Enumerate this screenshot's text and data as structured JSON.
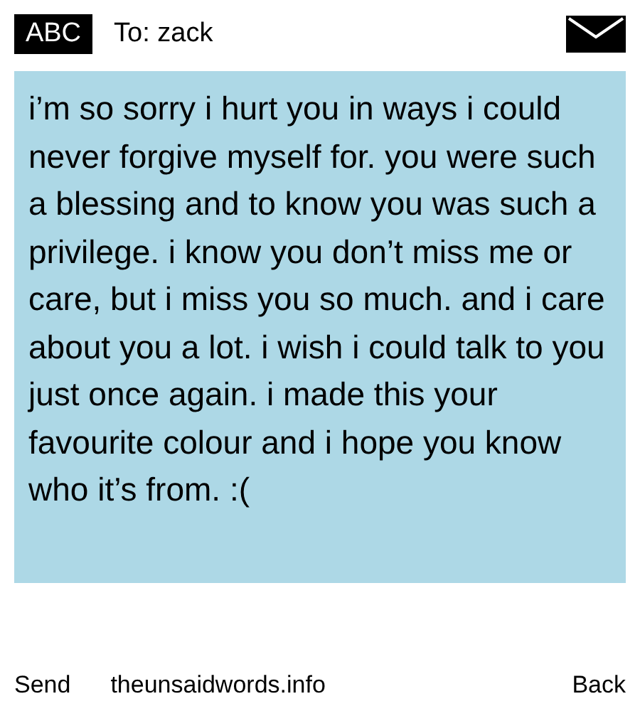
{
  "header": {
    "badge": "ABC",
    "recipient": "To: zack"
  },
  "message": {
    "text": "i’m so sorry i hurt you in ways i could never forgive myself for. you were such a blessing and to know you was such a privilege. i know you don’t miss me or care, but i miss you so much. and i care about you a lot. i wish i could talk to you just once again. i made this your favourite colour and i hope you know who it’s from. :(",
    "color": "#add8e6"
  },
  "footer": {
    "send": "Send",
    "site": "theunsaidwords.info",
    "back": "Back"
  }
}
